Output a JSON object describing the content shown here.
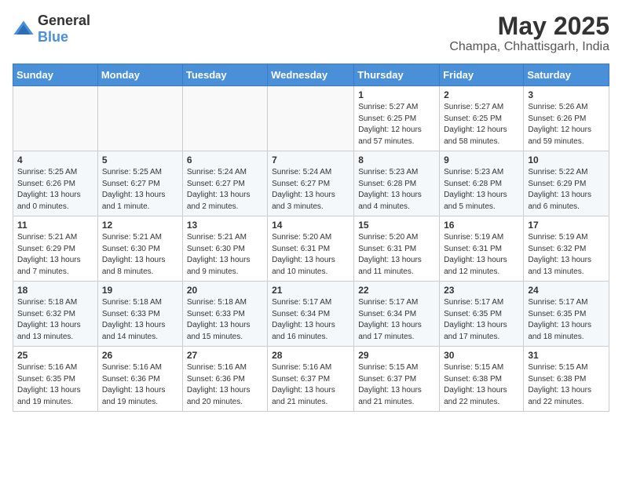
{
  "header": {
    "logo_general": "General",
    "logo_blue": "Blue",
    "month_title": "May 2025",
    "location": "Champa, Chhattisgarh, India"
  },
  "weekdays": [
    "Sunday",
    "Monday",
    "Tuesday",
    "Wednesday",
    "Thursday",
    "Friday",
    "Saturday"
  ],
  "weeks": [
    [
      {
        "day": "",
        "info": ""
      },
      {
        "day": "",
        "info": ""
      },
      {
        "day": "",
        "info": ""
      },
      {
        "day": "",
        "info": ""
      },
      {
        "day": "1",
        "info": "Sunrise: 5:27 AM\nSunset: 6:25 PM\nDaylight: 12 hours\nand 57 minutes."
      },
      {
        "day": "2",
        "info": "Sunrise: 5:27 AM\nSunset: 6:25 PM\nDaylight: 12 hours\nand 58 minutes."
      },
      {
        "day": "3",
        "info": "Sunrise: 5:26 AM\nSunset: 6:26 PM\nDaylight: 12 hours\nand 59 minutes."
      }
    ],
    [
      {
        "day": "4",
        "info": "Sunrise: 5:25 AM\nSunset: 6:26 PM\nDaylight: 13 hours\nand 0 minutes."
      },
      {
        "day": "5",
        "info": "Sunrise: 5:25 AM\nSunset: 6:27 PM\nDaylight: 13 hours\nand 1 minute."
      },
      {
        "day": "6",
        "info": "Sunrise: 5:24 AM\nSunset: 6:27 PM\nDaylight: 13 hours\nand 2 minutes."
      },
      {
        "day": "7",
        "info": "Sunrise: 5:24 AM\nSunset: 6:27 PM\nDaylight: 13 hours\nand 3 minutes."
      },
      {
        "day": "8",
        "info": "Sunrise: 5:23 AM\nSunset: 6:28 PM\nDaylight: 13 hours\nand 4 minutes."
      },
      {
        "day": "9",
        "info": "Sunrise: 5:23 AM\nSunset: 6:28 PM\nDaylight: 13 hours\nand 5 minutes."
      },
      {
        "day": "10",
        "info": "Sunrise: 5:22 AM\nSunset: 6:29 PM\nDaylight: 13 hours\nand 6 minutes."
      }
    ],
    [
      {
        "day": "11",
        "info": "Sunrise: 5:21 AM\nSunset: 6:29 PM\nDaylight: 13 hours\nand 7 minutes."
      },
      {
        "day": "12",
        "info": "Sunrise: 5:21 AM\nSunset: 6:30 PM\nDaylight: 13 hours\nand 8 minutes."
      },
      {
        "day": "13",
        "info": "Sunrise: 5:21 AM\nSunset: 6:30 PM\nDaylight: 13 hours\nand 9 minutes."
      },
      {
        "day": "14",
        "info": "Sunrise: 5:20 AM\nSunset: 6:31 PM\nDaylight: 13 hours\nand 10 minutes."
      },
      {
        "day": "15",
        "info": "Sunrise: 5:20 AM\nSunset: 6:31 PM\nDaylight: 13 hours\nand 11 minutes."
      },
      {
        "day": "16",
        "info": "Sunrise: 5:19 AM\nSunset: 6:31 PM\nDaylight: 13 hours\nand 12 minutes."
      },
      {
        "day": "17",
        "info": "Sunrise: 5:19 AM\nSunset: 6:32 PM\nDaylight: 13 hours\nand 13 minutes."
      }
    ],
    [
      {
        "day": "18",
        "info": "Sunrise: 5:18 AM\nSunset: 6:32 PM\nDaylight: 13 hours\nand 13 minutes."
      },
      {
        "day": "19",
        "info": "Sunrise: 5:18 AM\nSunset: 6:33 PM\nDaylight: 13 hours\nand 14 minutes."
      },
      {
        "day": "20",
        "info": "Sunrise: 5:18 AM\nSunset: 6:33 PM\nDaylight: 13 hours\nand 15 minutes."
      },
      {
        "day": "21",
        "info": "Sunrise: 5:17 AM\nSunset: 6:34 PM\nDaylight: 13 hours\nand 16 minutes."
      },
      {
        "day": "22",
        "info": "Sunrise: 5:17 AM\nSunset: 6:34 PM\nDaylight: 13 hours\nand 17 minutes."
      },
      {
        "day": "23",
        "info": "Sunrise: 5:17 AM\nSunset: 6:35 PM\nDaylight: 13 hours\nand 17 minutes."
      },
      {
        "day": "24",
        "info": "Sunrise: 5:17 AM\nSunset: 6:35 PM\nDaylight: 13 hours\nand 18 minutes."
      }
    ],
    [
      {
        "day": "25",
        "info": "Sunrise: 5:16 AM\nSunset: 6:35 PM\nDaylight: 13 hours\nand 19 minutes."
      },
      {
        "day": "26",
        "info": "Sunrise: 5:16 AM\nSunset: 6:36 PM\nDaylight: 13 hours\nand 19 minutes."
      },
      {
        "day": "27",
        "info": "Sunrise: 5:16 AM\nSunset: 6:36 PM\nDaylight: 13 hours\nand 20 minutes."
      },
      {
        "day": "28",
        "info": "Sunrise: 5:16 AM\nSunset: 6:37 PM\nDaylight: 13 hours\nand 21 minutes."
      },
      {
        "day": "29",
        "info": "Sunrise: 5:15 AM\nSunset: 6:37 PM\nDaylight: 13 hours\nand 21 minutes."
      },
      {
        "day": "30",
        "info": "Sunrise: 5:15 AM\nSunset: 6:38 PM\nDaylight: 13 hours\nand 22 minutes."
      },
      {
        "day": "31",
        "info": "Sunrise: 5:15 AM\nSunset: 6:38 PM\nDaylight: 13 hours\nand 22 minutes."
      }
    ]
  ]
}
